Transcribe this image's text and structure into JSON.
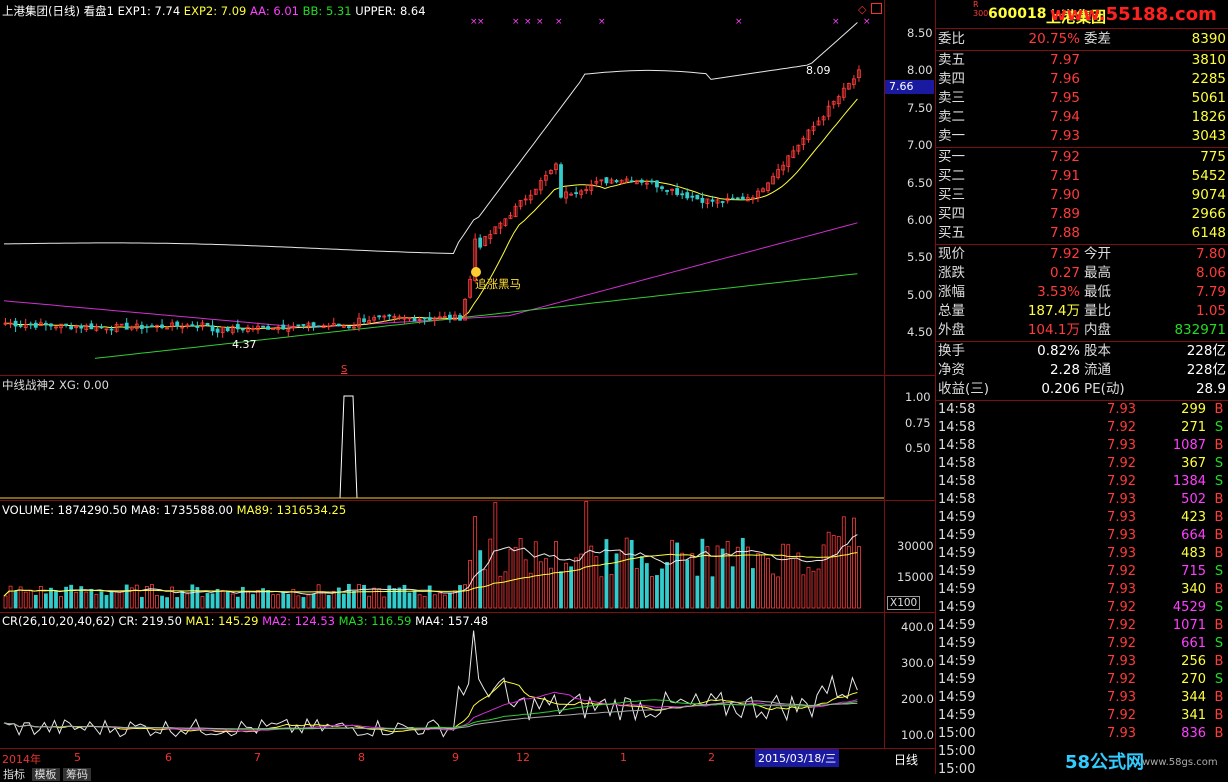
{
  "header": {
    "title": "上港集团(日线) 看盘1",
    "exp1": "EXP1: 7.74",
    "exp2": "EXP2: 7.09",
    "aa": "AA: 6.01",
    "bb": "BB: 5.31",
    "upper": "UPPER: 8.64"
  },
  "main_chart": {
    "price_ticks": [
      "8.50",
      "8.00",
      "7.50",
      "7.00",
      "6.50",
      "6.00",
      "5.50",
      "5.00",
      "4.50"
    ],
    "current_price_tag": "7.66",
    "high_label": "8.09",
    "low_label": "4.37",
    "signal_label": "追涨黑马",
    "signal_marker": "S"
  },
  "indicator1": {
    "title": "中线战神2 XG: 0.00",
    "ticks": [
      "1.00",
      "0.75",
      "0.50"
    ]
  },
  "volume": {
    "title": "VOLUME: 1874290.50",
    "ma8": "MA8: 1735588.00",
    "ma89": "MA89: 1316534.25",
    "ticks": [
      "30000",
      "15000"
    ],
    "unit": "X100"
  },
  "cr": {
    "title": "CR(26,10,20,40,62)",
    "cr": "CR: 219.50",
    "ma1": "MA1: 145.29",
    "ma2": "MA2: 124.53",
    "ma3": "MA3: 116.59",
    "ma4": "MA4: 157.48",
    "ticks": [
      "400.0",
      "300.0",
      "200.0",
      "100.0"
    ]
  },
  "date_axis": {
    "labels": [
      "2014年",
      "5",
      "6",
      "7",
      "8",
      "9",
      "12",
      "1",
      "2"
    ],
    "selected": "2015/03/18/三",
    "period": "日线"
  },
  "bottom_tabs": [
    "指标",
    "模板",
    "筹码",
    "",
    ""
  ],
  "watermark": "www.55188.com",
  "watermark2": "58公式网",
  "watermark3": "www.58gs.com",
  "quote": {
    "code": "600018",
    "name": "上港集团",
    "rows_top": [
      {
        "l": "委比",
        "v": "20.75%",
        "m": "委差",
        "v2": "8390",
        "c1": "red",
        "c2": "yellow"
      }
    ],
    "sell": [
      {
        "l": "卖五",
        "v": "7.97",
        "q": "3810"
      },
      {
        "l": "卖四",
        "v": "7.96",
        "q": "2285"
      },
      {
        "l": "卖三",
        "v": "7.95",
        "q": "5061"
      },
      {
        "l": "卖二",
        "v": "7.94",
        "q": "1826"
      },
      {
        "l": "卖一",
        "v": "7.93",
        "q": "3043"
      }
    ],
    "buy": [
      {
        "l": "买一",
        "v": "7.92",
        "q": "775"
      },
      {
        "l": "买二",
        "v": "7.91",
        "q": "5452"
      },
      {
        "l": "买三",
        "v": "7.90",
        "q": "9074"
      },
      {
        "l": "买四",
        "v": "7.89",
        "q": "2966"
      },
      {
        "l": "买五",
        "v": "7.88",
        "q": "6148"
      }
    ],
    "stats": [
      {
        "l": "现价",
        "v": "7.92",
        "m": "今开",
        "v2": "7.80",
        "c1": "red",
        "c2": "red"
      },
      {
        "l": "涨跌",
        "v": "0.27",
        "m": "最高",
        "v2": "8.06",
        "c1": "red",
        "c2": "red"
      },
      {
        "l": "涨幅",
        "v": "3.53%",
        "m": "最低",
        "v2": "7.79",
        "c1": "red",
        "c2": "red"
      },
      {
        "l": "总量",
        "v": "187.4万",
        "m": "量比",
        "v2": "1.05",
        "c1": "yellow",
        "c2": "red"
      },
      {
        "l": "外盘",
        "v": "104.1万",
        "m": "内盘",
        "v2": "832971",
        "c1": "red",
        "c2": "green"
      }
    ],
    "stats2": [
      {
        "l": "换手",
        "v": "0.82%",
        "m": "股本",
        "v2": "228亿",
        "c1": "white",
        "c2": "white"
      },
      {
        "l": "净资",
        "v": "2.28",
        "m": "流通",
        "v2": "228亿",
        "c1": "white",
        "c2": "white"
      },
      {
        "l": "收益(三)",
        "v": "0.206",
        "m": "PE(动)",
        "v2": "28.9",
        "c1": "white",
        "c2": "white"
      }
    ],
    "ticks": [
      {
        "t": "14:58",
        "p": "7.93",
        "q": "299",
        "s": "B",
        "pc": "red",
        "qc": "yellow"
      },
      {
        "t": "14:58",
        "p": "7.92",
        "q": "271",
        "s": "S",
        "pc": "red",
        "qc": "yellow"
      },
      {
        "t": "14:58",
        "p": "7.93",
        "q": "1087",
        "s": "B",
        "pc": "red",
        "qc": "magenta"
      },
      {
        "t": "14:58",
        "p": "7.92",
        "q": "367",
        "s": "S",
        "pc": "red",
        "qc": "yellow"
      },
      {
        "t": "14:58",
        "p": "7.92",
        "q": "1384",
        "s": "S",
        "pc": "red",
        "qc": "magenta"
      },
      {
        "t": "14:58",
        "p": "7.93",
        "q": "502",
        "s": "B",
        "pc": "red",
        "qc": "magenta"
      },
      {
        "t": "14:59",
        "p": "7.93",
        "q": "423",
        "s": "B",
        "pc": "red",
        "qc": "yellow"
      },
      {
        "t": "14:59",
        "p": "7.93",
        "q": "664",
        "s": "B",
        "pc": "red",
        "qc": "magenta"
      },
      {
        "t": "14:59",
        "p": "7.93",
        "q": "483",
        "s": "B",
        "pc": "red",
        "qc": "yellow"
      },
      {
        "t": "14:59",
        "p": "7.92",
        "q": "715",
        "s": "S",
        "pc": "red",
        "qc": "magenta"
      },
      {
        "t": "14:59",
        "p": "7.93",
        "q": "340",
        "s": "B",
        "pc": "red",
        "qc": "yellow"
      },
      {
        "t": "14:59",
        "p": "7.92",
        "q": "4529",
        "s": "S",
        "pc": "red",
        "qc": "magenta"
      },
      {
        "t": "14:59",
        "p": "7.92",
        "q": "1071",
        "s": "B",
        "pc": "red",
        "qc": "magenta"
      },
      {
        "t": "14:59",
        "p": "7.92",
        "q": "661",
        "s": "S",
        "pc": "red",
        "qc": "magenta"
      },
      {
        "t": "14:59",
        "p": "7.93",
        "q": "256",
        "s": "B",
        "pc": "red",
        "qc": "yellow"
      },
      {
        "t": "14:59",
        "p": "7.92",
        "q": "270",
        "s": "S",
        "pc": "red",
        "qc": "yellow"
      },
      {
        "t": "14:59",
        "p": "7.93",
        "q": "344",
        "s": "B",
        "pc": "red",
        "qc": "yellow"
      },
      {
        "t": "14:59",
        "p": "7.92",
        "q": "341",
        "s": "B",
        "pc": "red",
        "qc": "yellow"
      },
      {
        "t": "15:00",
        "p": "7.93",
        "q": "836",
        "s": "B",
        "pc": "red",
        "qc": "magenta"
      },
      {
        "t": "15:00",
        "p": "",
        "q": "",
        "s": "",
        "pc": "red",
        "qc": "yellow"
      },
      {
        "t": "15:00",
        "p": "",
        "q": "",
        "s": "",
        "pc": "red",
        "qc": "yellow"
      }
    ]
  },
  "colors": {
    "grid": "#7a1010",
    "up": "#ff3b3b",
    "down": "#33cccc",
    "ma_white": "#e8e8e8",
    "ma_yellow": "#ffff3c",
    "ma_magenta": "#d030d0",
    "ma_green": "#33cc33"
  }
}
